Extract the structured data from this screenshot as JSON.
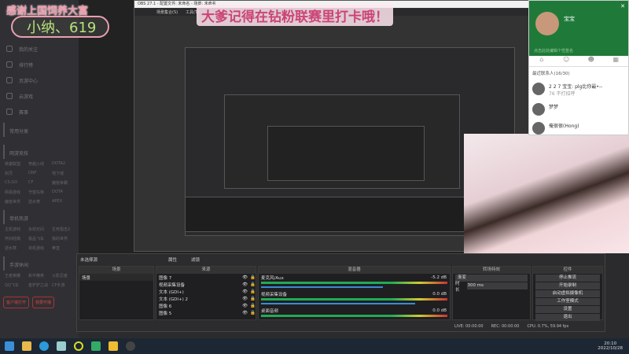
{
  "sidebar": {
    "nav": [
      "我的关注",
      "排行榜",
      "页游中心",
      "云游戏",
      "赛事"
    ],
    "sections": [
      {
        "title": "常用分类",
        "items": []
      },
      {
        "title": "网游竞技",
        "items": [
          "英雄联盟",
          "穿越火线",
          "DOTA2",
          "剑灵",
          "DNF",
          "地下城",
          "CS:GO",
          "CF",
          "魔兽争霸",
          "网易游戏",
          "守望先锋",
          "DOTA",
          "魔兽世界",
          "逆水寒",
          "APEX"
        ]
      },
      {
        "title": "单机热游",
        "items": [
          "主机游戏",
          "永劫无间",
          "生死狙击2",
          "怀旧经典",
          "极品飞车",
          "我的世界",
          "逆水寒",
          "单机游戏",
          "拳皇"
        ]
      },
      {
        "title": "手游休闲",
        "items": [
          "王者荣耀",
          "和平精英",
          "火影忍者",
          "QQ飞车",
          "金铲铲之战",
          "CF手游"
        ]
      }
    ],
    "buttons": [
      "客户端打开",
      "我要开播"
    ]
  },
  "overlay": {
    "thanks": "感谢上国饲养大富",
    "name": "小纳、619",
    "banner": "大爹记得在钻粉联赛里打卡哦！"
  },
  "preview": {
    "window_title": "OBS 27.1  - 配置文件: 未命名 - 场景: 未命名",
    "menu": [
      "场景集合(S)",
      "工具(T)"
    ]
  },
  "chat": {
    "username": "宝宝",
    "signature": "点击此处编辑个性签名",
    "tabs": [
      "home",
      "contacts",
      "friends",
      "apps"
    ],
    "group": "最近联系人(16/30)",
    "contacts": [
      {
        "name": "2 2 7 宝宝: plg比你最•--",
        "msg": "76 不打招呼"
      },
      {
        "name": "梦梦",
        "msg": ""
      },
      {
        "name": "俺很很(Hong)",
        "msg": ""
      }
    ]
  },
  "obs": {
    "no_source": "未选择源",
    "properties": "属性",
    "filters": "滤镜",
    "scenes": {
      "title": "场景",
      "items": [
        "场景"
      ]
    },
    "sources": {
      "title": "来源",
      "items": [
        "图像 7",
        "视频采集设备",
        "文本 (GDI+)",
        "文本 (GDI+) 2",
        "图像 6",
        "图像 5"
      ]
    },
    "mixer": {
      "title": "混音器",
      "channels": [
        {
          "name": "麦克风/Aux",
          "db": "-5.2 dB",
          "level": 0.75
        },
        {
          "name": "视频采集设备",
          "db": "0.0 dB",
          "level": 0.95
        },
        {
          "name": "桌面音频",
          "db": "0.0 dB",
          "level": 0
        }
      ]
    },
    "transitions": {
      "title": "转场特效",
      "type": "渐变",
      "duration_label": "时长",
      "duration": "300 ms"
    },
    "controls": {
      "title": "控件",
      "buttons": [
        "停止推流",
        "开始录制",
        "启动虚拟摄像机",
        "工作室模式",
        "设置",
        "退出"
      ]
    },
    "status": {
      "live": "LIVE: 00:00:00",
      "rec": "REC: 00:00:00",
      "cpu": "CPU: 0.7%, 59.94 fps"
    }
  },
  "taskbar": {
    "time": "20:10",
    "date": "2022/10/28"
  }
}
